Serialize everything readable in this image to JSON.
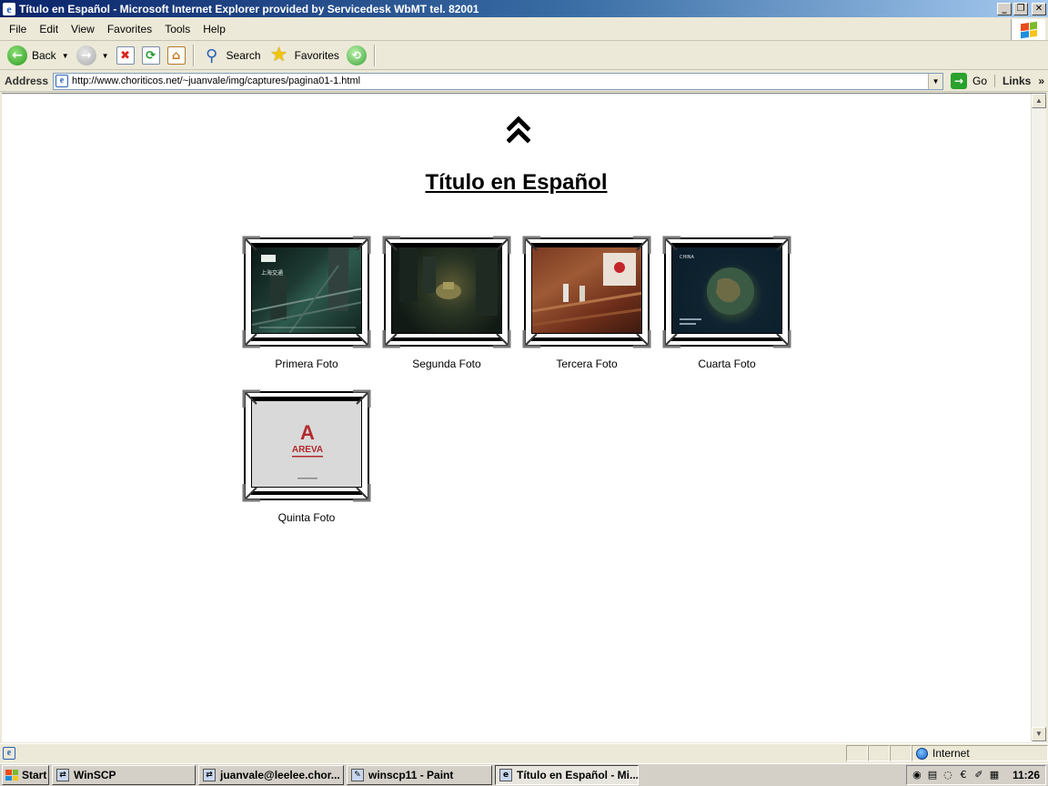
{
  "window": {
    "title": "Título en Español - Microsoft Internet Explorer provided by Servicedesk WbMT tel. 82001",
    "controls": {
      "minimize": "_",
      "restore": "❐",
      "close": "✕"
    }
  },
  "menu": [
    "File",
    "Edit",
    "View",
    "Favorites",
    "Tools",
    "Help"
  ],
  "toolbar": {
    "back_label": "Back",
    "search_label": "Search",
    "favorites_label": "Favorites"
  },
  "address": {
    "label": "Address",
    "url": "http://www.choriticos.net/~juanvale/img/captures/pagina01-1.html",
    "go_label": "Go",
    "links_label": "Links",
    "links_chevron": "»"
  },
  "page": {
    "title": "Título en Español",
    "thumbnails": [
      {
        "caption": "Primera Foto",
        "overlay_text": "上海交通"
      },
      {
        "caption": "Segunda Foto"
      },
      {
        "caption": "Tercera Foto"
      },
      {
        "caption": "Cuarta Foto",
        "overlay_text": "CHINA"
      },
      {
        "caption": "Quinta Foto",
        "overlay_text": "AREVA",
        "overlay_logo": "A"
      }
    ]
  },
  "status": {
    "zone": "Internet"
  },
  "taskbar": {
    "start_label": "Start",
    "tasks": [
      {
        "label": "WinSCP"
      },
      {
        "label": "juanvale@leelee.chor..."
      },
      {
        "label": "winscp11 - Paint"
      },
      {
        "label": "Título en Español - Mi..."
      }
    ],
    "clock": "11:26"
  },
  "colors": {
    "titlebar": "#0a246a",
    "chrome": "#ece9d8",
    "page_bg": "#ffffff",
    "areva_red": "#b22a2e"
  }
}
